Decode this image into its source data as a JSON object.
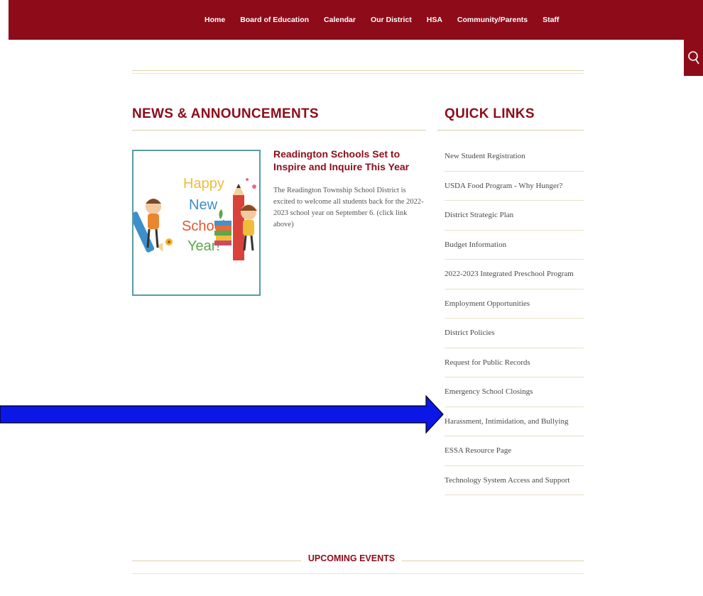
{
  "nav": {
    "items": [
      "Home",
      "Board of Education",
      "Calendar",
      "Our District",
      "HSA",
      "Community/Parents",
      "Staff"
    ]
  },
  "search": {
    "icon": "search-icon"
  },
  "news": {
    "heading": "NEWS & ANNOUNCEMENTS",
    "article": {
      "title": "Readington Schools Set to Inspire and Inquire This Year",
      "body": "The Readington Township School District is excited to welcome all students back for the 2022-2023 school year on September 6. (click link above)",
      "image_text": [
        "Happy",
        "New",
        "School",
        "Year!"
      ]
    }
  },
  "quick_links": {
    "heading": "QUICK LINKS",
    "items": [
      "New Student Registration",
      "USDA Food Program - Why Hunger?",
      "District Strategic Plan",
      "Budget Information",
      "2022-2023 Integrated Preschool Program",
      "Employment Opportunities",
      "District Policies",
      "Request for Public Records",
      "Emergency School Closings",
      "Harassment, Intimidation, and Bullying",
      "ESSA Resource Page",
      "Technology System Access and Support"
    ]
  },
  "events": {
    "heading": "UPCOMING EVENTS"
  },
  "colors": {
    "brand": "#8e0c1a",
    "rule": "#d9d2aa",
    "arrow": "#0a17e6"
  }
}
